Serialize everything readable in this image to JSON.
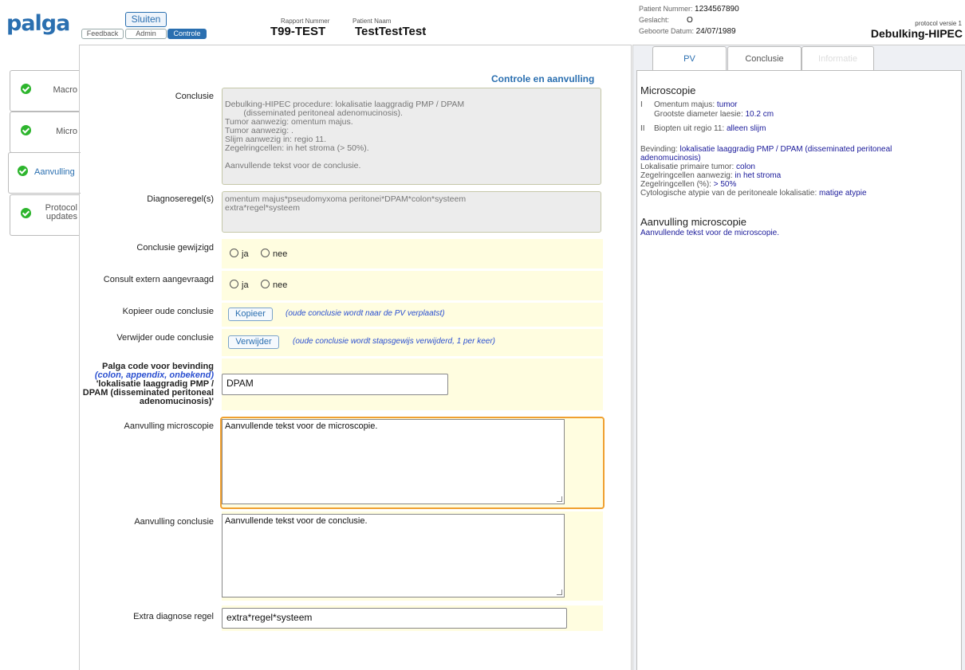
{
  "header": {
    "logo": "palga",
    "close_label": "Sluiten",
    "buttons": [
      "Feedback",
      "Admin",
      "Controle"
    ],
    "rapport_label": "Rapport Nummer",
    "rapport_value": "T99-TEST",
    "patient_naam_label": "Patient Naam",
    "patient_naam_value": "TestTestTest",
    "patient_nummer_label": "Patient Nummer:",
    "patient_nummer_value": "1234567890",
    "geslacht_label": "Geslacht:",
    "geslacht_value": "O",
    "geboorte_label": "Geboorte Datum:",
    "geboorte_value": "24/07/1989",
    "protocol_versie": "protocol versie 1",
    "protocol_name": "Debulking-HIPEC"
  },
  "nav": [
    {
      "label": "Macro"
    },
    {
      "label": "Micro"
    },
    {
      "label": "Aanvulling"
    },
    {
      "label": "Protocol updates"
    }
  ],
  "main": {
    "title": "Controle en aanvulling",
    "conclusie_label": "Conclusie",
    "conclusie_text": "Debulking-HIPEC procedure: lokalisatie laaggradig PMP / DPAM\n        (disseminated peritoneal adenomucinosis).\nTumor aanwezig: omentum majus.\nTumor aanwezig: .\nSlijm aanwezig in: regio 11.\nZegelringcellen: in het stroma (> 50%).\n\nAanvullende tekst voor de conclusie.",
    "diagnose_label": "Diagnoseregel(s)",
    "diagnose_text": "omentum majus*pseudomyxoma peritonei*DPAM*colon*systeem\nextra*regel*systeem",
    "gewijzigd_label": "Conclusie gewijzigd",
    "consult_label": "Consult extern aangevraagd",
    "ja": "ja",
    "nee": "nee",
    "kopieer_label": "Kopieer oude conclusie",
    "kopieer_btn": "Kopieer",
    "kopieer_hint": "(oude conclusie wordt naar de PV verplaatst)",
    "verwijder_label": "Verwijder oude conclusie",
    "verwijder_btn": "Verwijder",
    "verwijder_hint": "(oude conclusie wordt stapsgewijs verwijderd, 1 per keer)",
    "palga_code_line1": "Palga code voor  bevinding",
    "palga_code_line2": "(colon, appendix, onbekend)",
    "palga_code_line3": "'lokalisatie laaggradig PMP /",
    "palga_code_line4": "DPAM (disseminated peritoneal",
    "palga_code_line5": "adenomucinosis)'",
    "palga_code_value": "DPAM",
    "aanv_micro_label": "Aanvulling microscopie",
    "aanv_micro_value": "Aanvullende tekst voor de microscopie.",
    "aanv_concl_label": "Aanvulling conclusie",
    "aanv_concl_value": "Aanvullende tekst voor de conclusie.",
    "extra_label": "Extra diagnose regel",
    "extra_value": "extra*regel*systeem"
  },
  "right": {
    "tabs": [
      "PV",
      "Conclusie",
      "Informatie"
    ],
    "micro_title": "Microscopie",
    "item1_num": "I",
    "item1_label": "Omentum majus:",
    "item1_value": "tumor",
    "item1_sub_label": "Grootste diameter laesie:",
    "item1_sub_value": "10.2 cm",
    "item2_num": "II",
    "item2_label": "Biopten uit regio 11:",
    "item2_value": "alleen slijm",
    "bevinding_label": "Bevinding:",
    "bevinding_value1": "lokalisatie laaggradig PMP / DPAM (disseminated peritoneal",
    "bevinding_value2": "adenomucinosis)",
    "lok_label": "Lokalisatie primaire tumor:",
    "lok_value": "colon",
    "zeg_label": "Zegelringcellen aanwezig:",
    "zeg_value": "in het stroma",
    "zegp_label": "Zegelringcellen (%):",
    "zegp_value": "> 50%",
    "cyto_label": "Cytologische atypie van de peritoneale lokalisatie:",
    "cyto_value": "matige atypie",
    "aanv_title": "Aanvulling microscopie",
    "aanv_text": "Aanvullende tekst voor de microscopie."
  }
}
